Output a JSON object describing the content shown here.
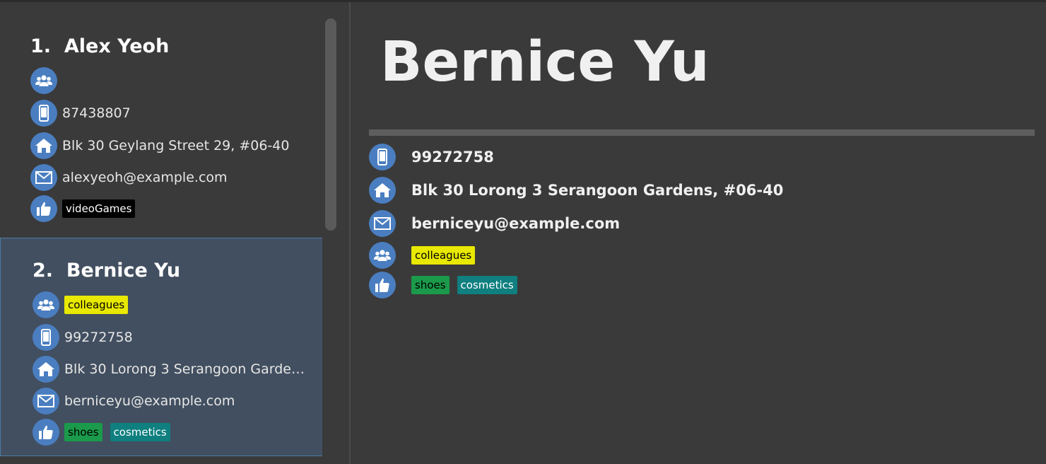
{
  "persons": [
    {
      "index_label": "1.",
      "name": "Alex Yeoh",
      "phone": "87438807",
      "address": "Blk 30 Geylang Street 29, #06-40",
      "email": "alexyeoh@example.com",
      "interest_tags": [
        "videoGames"
      ]
    },
    {
      "index_label": "2.",
      "name": "Bernice Yu",
      "group_tags": [
        "colleagues"
      ],
      "phone": "99272758",
      "address": "Blk 30 Lorong 3 Serangoon Gardens, #...",
      "email": "berniceyu@example.com",
      "interest_tags": [
        "shoes",
        "cosmetics"
      ]
    }
  ],
  "detail": {
    "name": "Bernice Yu",
    "phone": "99272758",
    "address": "Blk 30 Lorong 3 Serangoon Gardens, #06-40",
    "email": "berniceyu@example.com",
    "group_tags": [
      "colleagues"
    ],
    "interest_tags": [
      "shoes",
      "cosmetics"
    ]
  },
  "icons": {
    "group": "group-icon",
    "phone": "phone-icon",
    "address": "home-icon",
    "email": "email-icon",
    "interest": "thumbs-up-icon"
  },
  "colors": {
    "icon_bg": "#4a7ec0",
    "selected_card": "#424f60",
    "tag_videoGames": "#000000",
    "tag_colleagues": "#e8e800",
    "tag_shoes": "#1a9a4a",
    "tag_cosmetics": "#0f7f7f"
  }
}
